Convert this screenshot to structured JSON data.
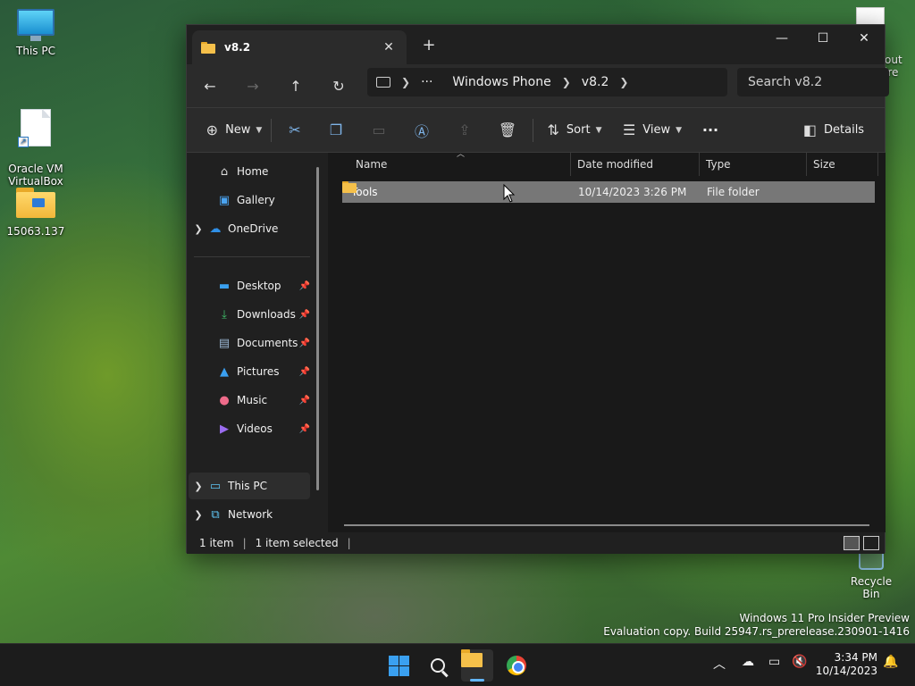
{
  "desktop": {
    "icons": [
      {
        "label": "This PC"
      },
      {
        "label": "Oracle VM\nVirtualBox"
      },
      {
        "label": "15063.137"
      }
    ],
    "recycle_bin": "Recycle Bin",
    "partial_label": "out\nire",
    "watermark_line1": "Windows 11 Pro Insider Preview",
    "watermark_line2": "Evaluation copy. Build 25947.rs_prerelease.230901-1416"
  },
  "window": {
    "tab_title": "v8.2",
    "tab_close": "✕",
    "new_tab": "+",
    "controls": {
      "minimize": "—",
      "maximize": "☐",
      "close": "✕"
    },
    "breadcrumb": {
      "more": "···",
      "items": [
        "Windows Phone",
        "v8.2"
      ]
    },
    "search_placeholder": "Search v8.2",
    "toolbar": {
      "new_label": "New",
      "sort_label": "Sort",
      "view_label": "View",
      "more_label": "···",
      "details_label": "Details"
    },
    "nav": {
      "home": "Home",
      "gallery": "Gallery",
      "onedrive": "OneDrive",
      "quick_access": [
        {
          "label": "Desktop"
        },
        {
          "label": "Downloads"
        },
        {
          "label": "Documents"
        },
        {
          "label": "Pictures"
        },
        {
          "label": "Music"
        },
        {
          "label": "Videos"
        }
      ],
      "this_pc": "This PC",
      "network": "Network"
    },
    "columns": {
      "name": "Name",
      "date": "Date modified",
      "type": "Type",
      "size": "Size"
    },
    "files": [
      {
        "name": "Tools",
        "date": "10/14/2023 3:26 PM",
        "type": "File folder",
        "size": ""
      }
    ],
    "status": {
      "count": "1 item",
      "selected": "1 item selected"
    }
  },
  "taskbar": {
    "time": "3:34 PM",
    "date": "10/14/2023"
  },
  "colors": {
    "accent": "#3aa0f0",
    "window_bg": "#202020",
    "selection": "#777777"
  }
}
